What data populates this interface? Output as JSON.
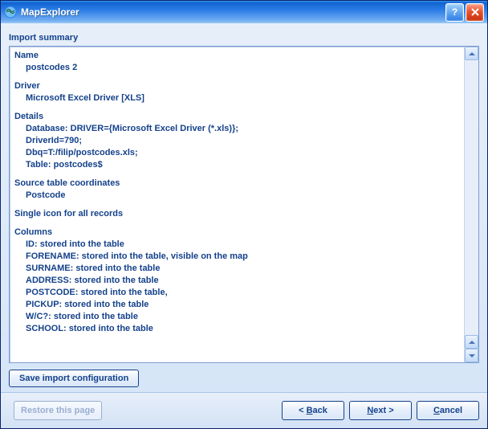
{
  "window": {
    "title": "MapExplorer"
  },
  "heading": "Import summary",
  "summary": {
    "name_label": "Name",
    "name_value": "postcodes 2",
    "driver_label": "Driver",
    "driver_value": "Microsoft Excel Driver [XLS]",
    "details_label": "Details",
    "details_line1": "Database: DRIVER={Microsoft Excel Driver (*.xls)};",
    "details_line2": "DriverId=790;",
    "details_line3": "Dbq=T:/filip/postcodes.xls;",
    "details_line4": "Table: postcodes$",
    "source_coords_label": "Source table coordinates",
    "source_coords_value": "Postcode",
    "single_icon": "Single icon for all records",
    "columns_label": "Columns",
    "col1": "ID: stored into the table",
    "col2": "FORENAME: stored into the table, visible on the map",
    "col3": "SURNAME: stored into the table",
    "col4": "ADDRESS: stored into the table",
    "col5": "POSTCODE: stored into the table,",
    "col6": "PICKUP: stored into the table",
    "col7": "W/C?: stored into the table",
    "col8": "SCHOOL: stored into the table"
  },
  "buttons": {
    "save_config": "Save import configuration",
    "restore": "Restore this page",
    "back_prefix": "< ",
    "back_u": "B",
    "back_rest": "ack",
    "next_u": "N",
    "next_rest": "ext >",
    "cancel_u": "C",
    "cancel_rest": "ancel"
  }
}
